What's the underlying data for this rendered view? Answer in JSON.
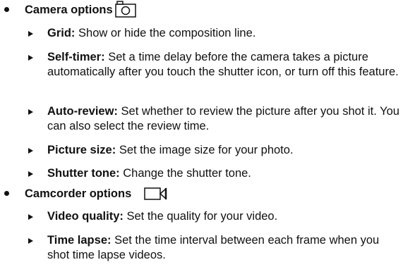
{
  "camera_section": {
    "title": "Camera options",
    "icon": "camera-icon",
    "items": [
      {
        "term": "Grid:",
        "desc": "Show or hide the composition line."
      },
      {
        "term": "Self-timer:",
        "desc": "Set a time delay before the camera takes a picture automatically after you touch the shutter icon, or turn off this feature."
      },
      {
        "term": "Auto-review:",
        "desc": "Set whether to review the picture after you shot it. You can also select the review time."
      },
      {
        "term": "Picture size:",
        "desc": "Set the image size for your photo."
      },
      {
        "term": "Shutter tone:",
        "desc": "Change the shutter tone."
      }
    ]
  },
  "camcorder_section": {
    "title": "Camcorder options",
    "icon": "video-camera-icon",
    "items": [
      {
        "term": "Video quality:",
        "desc": "Set the quality for your video."
      },
      {
        "term": "Time lapse:",
        "desc": "Set the time interval between each frame when you shot time lapse videos."
      }
    ]
  }
}
